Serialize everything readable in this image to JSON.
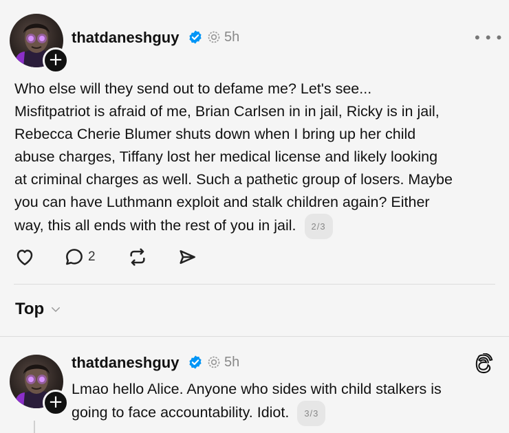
{
  "post1": {
    "username": "thatdaneshguy",
    "time": "5h",
    "more_icon": "more-icon",
    "lines": [
      "Who else will they send out to defame me? Let's see...",
      "Misfitpatriot is afraid of me, Brian Carlsen in in jail, Ricky is in jail,",
      "Rebecca Cherie Blumer shuts down when I bring up her child",
      "abuse charges, Tiffany lost her medical license and likely looking",
      "at criminal charges as well. Such a pathetic group of losers. Maybe",
      "you can have Luthmann exploit and stalk children again? Either",
      "way, this all ends with the rest of you in jail."
    ],
    "page_indicator": "2/3",
    "reply_count": "2"
  },
  "sort": {
    "label": "Top"
  },
  "post2": {
    "username": "thatdaneshguy",
    "time": "5h",
    "lines": [
      "Lmao hello Alice. Anyone who sides with child stalkers is",
      "going to face accountability. Idiot."
    ],
    "page_indicator": "3/3"
  },
  "colors": {
    "verified": "#0095f6",
    "background": "#f5f5f5",
    "avatar_glow": "#b84dff"
  }
}
